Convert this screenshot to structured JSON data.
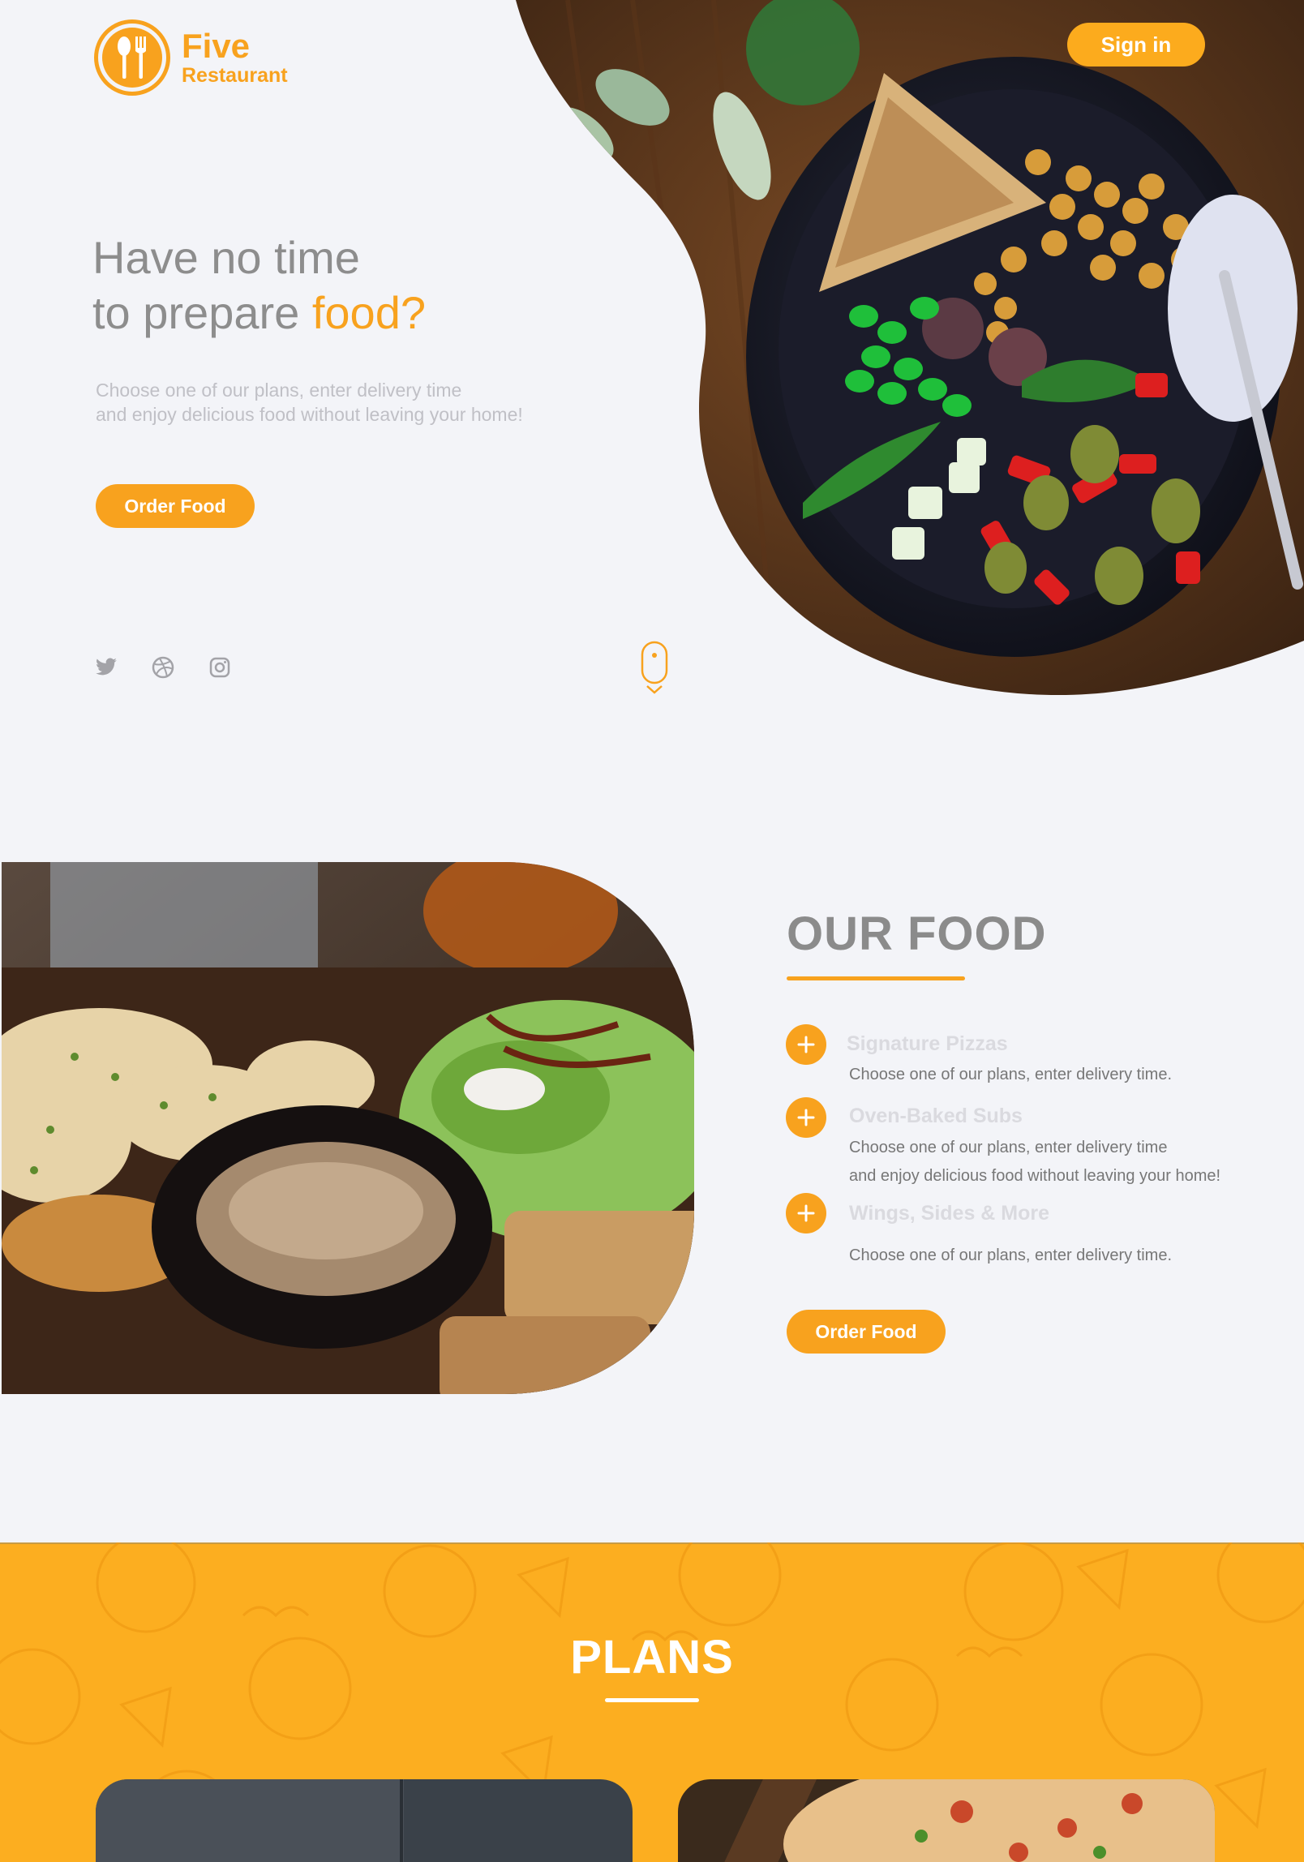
{
  "brand": {
    "name": "Five",
    "subtitle": "Restaurant",
    "accent_color": "#f8a21e"
  },
  "header": {
    "signin_label": "Sign in"
  },
  "hero": {
    "title_line1": "Have no time",
    "title_line2_prefix": "to prepare ",
    "title_line2_accent": "food?",
    "desc_line1": "Choose one of our plans, enter delivery time",
    "desc_line2": "and enjoy delicious food without leaving your home!",
    "order_label": "Order Food",
    "social_icons": [
      "twitter-icon",
      "dribbble-icon",
      "instagram-icon"
    ],
    "scroll_icon": "mouse-scroll-icon"
  },
  "our_food": {
    "title": "OUR FOOD",
    "items": [
      {
        "title": "Signature Pizzas",
        "desc_lines": [
          "Choose one of our plans, enter delivery time."
        ],
        "icon": "plus-icon"
      },
      {
        "title": "Oven-Baked Subs",
        "desc_lines": [
          "Choose one of our plans, enter delivery time",
          "and enjoy delicious food without leaving your home!"
        ],
        "icon": "plus-icon"
      },
      {
        "title": "Wings, Sides & More",
        "desc_lines": [
          "Choose one of our plans, enter delivery time."
        ],
        "icon": "plus-icon"
      }
    ],
    "order_label": "Order Food"
  },
  "plans": {
    "title": "PLANS",
    "background_color": "#fcae20"
  }
}
